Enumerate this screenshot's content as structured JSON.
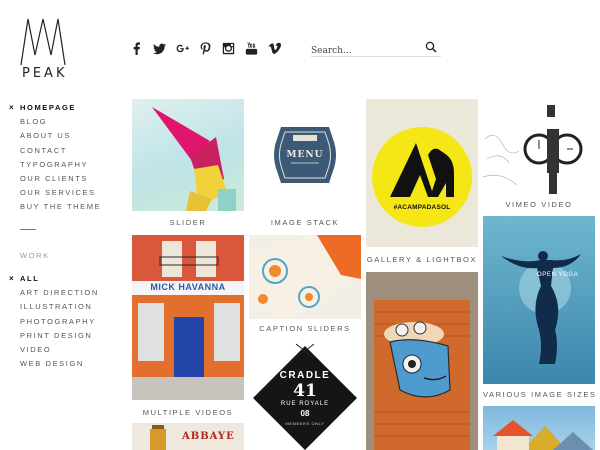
{
  "logo": {
    "text": "PEAK"
  },
  "nav": {
    "items": [
      {
        "label": "HOMEPAGE",
        "active": true
      },
      {
        "label": "BLOG"
      },
      {
        "label": "ABOUT US"
      },
      {
        "label": "CONTACT"
      },
      {
        "label": "TYPOGRAPHY"
      },
      {
        "label": "OUR CLIENTS"
      },
      {
        "label": "OUR SERVICES"
      },
      {
        "label": "BUY THE THEME"
      }
    ],
    "active_marker": "×"
  },
  "work": {
    "label": "WORK",
    "filters": [
      {
        "label": "ALL",
        "active": true
      },
      {
        "label": "ART DIRECTION"
      },
      {
        "label": "ILLUSTRATION"
      },
      {
        "label": "PHOTOGRAPHY"
      },
      {
        "label": "PRINT DESIGN"
      },
      {
        "label": "VIDEO"
      },
      {
        "label": "WEB DESIGN"
      }
    ]
  },
  "social": [
    "facebook-icon",
    "twitter-icon",
    "google-plus-icon",
    "pinterest-icon",
    "instagram-icon",
    "youtube-icon",
    "vimeo-icon"
  ],
  "search": {
    "placeholder": "Search..."
  },
  "portfolio": [
    {
      "caption": "SLIDER"
    },
    {
      "caption": "IMAGE STACK",
      "art_text": "MENU"
    },
    {
      "caption": "GALLERY & LIGHTBOX",
      "art_text": "#ACAMPADASOL"
    },
    {
      "caption": "VIMEO VIDEO"
    },
    {
      "caption": "MULTIPLE VIDEOS",
      "art_text": "MICK HAVANNA"
    },
    {
      "caption": "CAPTION SLIDERS"
    },
    {
      "caption": "VARIOUS IMAGE SIZES",
      "art_text": "OPEN YOGA"
    },
    {
      "caption": "",
      "art_text": "CRADLE",
      "art_number": "41",
      "art_sub": "RUE ROYALE",
      "art_small": "08",
      "art_members": "MEMBERS ONLY"
    },
    {
      "caption": "",
      "art_text": "ABBAYE"
    }
  ],
  "colors": {
    "accent": "#f5e616",
    "orange": "#e2692a",
    "teal": "#4b8ab0"
  }
}
